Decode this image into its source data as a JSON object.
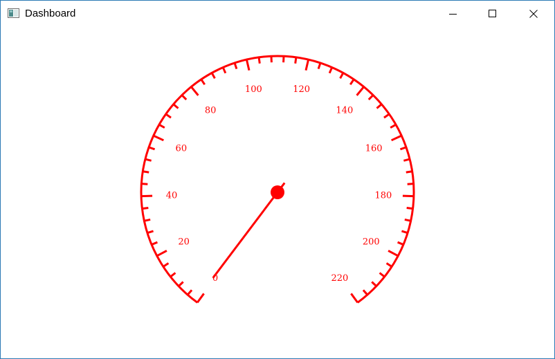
{
  "window": {
    "title": "Dashboard",
    "buttons": {
      "minimize": "minimize",
      "maximize": "maximize",
      "close": "close"
    }
  },
  "gauge": {
    "min": 0,
    "max": 220,
    "major_step": 20,
    "minor_step": 4,
    "start_angle_deg": 234,
    "end_angle_deg": -54,
    "labels": [
      "0",
      "20",
      "40",
      "60",
      "80",
      "100",
      "120",
      "140",
      "160",
      "180",
      "200",
      "220"
    ],
    "value": 0,
    "needle_angle_deg": 233,
    "color": "#ff0000"
  }
}
